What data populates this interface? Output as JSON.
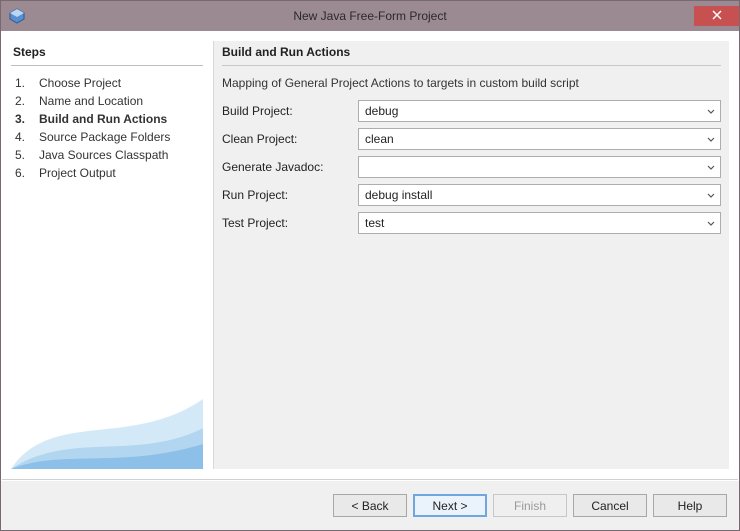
{
  "window": {
    "title": "New Java Free-Form Project"
  },
  "steps": {
    "header": "Steps",
    "items": [
      {
        "num": "1.",
        "label": "Choose Project"
      },
      {
        "num": "2.",
        "label": "Name and Location"
      },
      {
        "num": "3.",
        "label": "Build and Run Actions"
      },
      {
        "num": "4.",
        "label": "Source Package Folders"
      },
      {
        "num": "5.",
        "label": "Java Sources Classpath"
      },
      {
        "num": "6.",
        "label": "Project Output"
      }
    ],
    "current_index": 2
  },
  "main": {
    "header": "Build and Run Actions",
    "subtext": "Mapping of General Project Actions to targets in custom build script",
    "fields": {
      "build": {
        "label": "Build Project:",
        "value": "debug"
      },
      "clean": {
        "label": "Clean Project:",
        "value": "clean"
      },
      "javadoc": {
        "label": "Generate Javadoc:",
        "value": ""
      },
      "run": {
        "label": "Run Project:",
        "value": "debug install"
      },
      "test": {
        "label": "Test Project:",
        "value": "test"
      }
    }
  },
  "footer": {
    "back": "< Back",
    "next": "Next >",
    "finish": "Finish",
    "cancel": "Cancel",
    "help": "Help"
  }
}
